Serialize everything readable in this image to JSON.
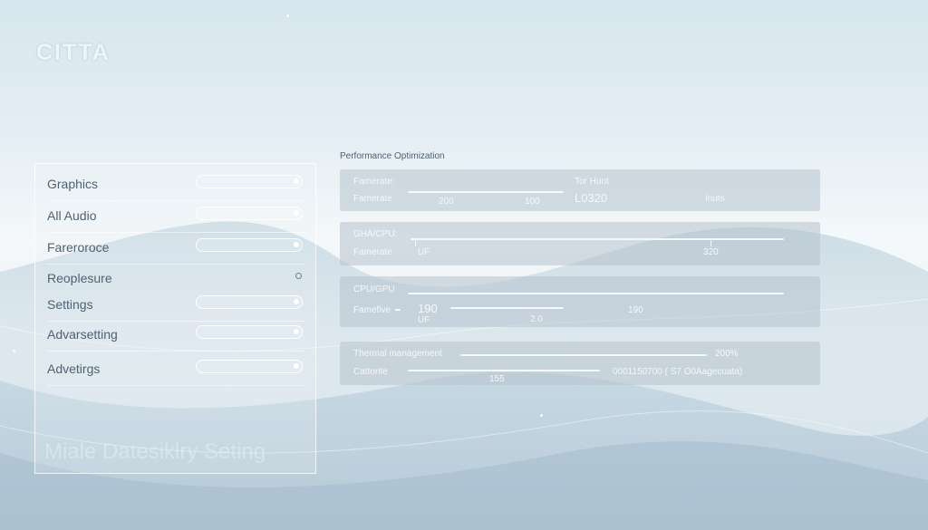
{
  "app": {
    "logo": "CITTA"
  },
  "settings_menu": {
    "items": [
      {
        "label": "Graphics",
        "control": "toggle"
      },
      {
        "label": "All Audio",
        "control": "toggle"
      },
      {
        "label": "Fareroroce",
        "control": "toggle"
      },
      {
        "label": "Reoplesure",
        "control": "ring"
      },
      {
        "label": "Settings",
        "control": "toggle"
      },
      {
        "label": "Advarsetting",
        "control": "toggle"
      },
      {
        "label": "Advetirgs",
        "control": "toggle"
      }
    ],
    "watermark": "Miale Datesiklry Seting"
  },
  "performance": {
    "heading": "Performance Optimization",
    "card1": {
      "label_top": "Famerate:",
      "label_bottom": "Famerate",
      "val_a": "200",
      "val_b": "100",
      "title_right": "Tor Hunt",
      "value_right": "L0320",
      "unit": "Inuts"
    },
    "card2": {
      "label_top": "GHA/CPU:",
      "label_bottom": "Famerate",
      "marker": "UF",
      "value": "320"
    },
    "card3": {
      "label_top": "CPU/GPU",
      "label_bottom": "Famefive",
      "value_left": "190",
      "marker": "UF",
      "val_mid": "2.0",
      "value_right": "190"
    },
    "card4": {
      "label_top": "Thermal management",
      "percent": "200%",
      "label_bottom": "Cattorite",
      "value_mid": "155",
      "readout": "0001150700 ( S7 O0Aagecuata)"
    }
  }
}
